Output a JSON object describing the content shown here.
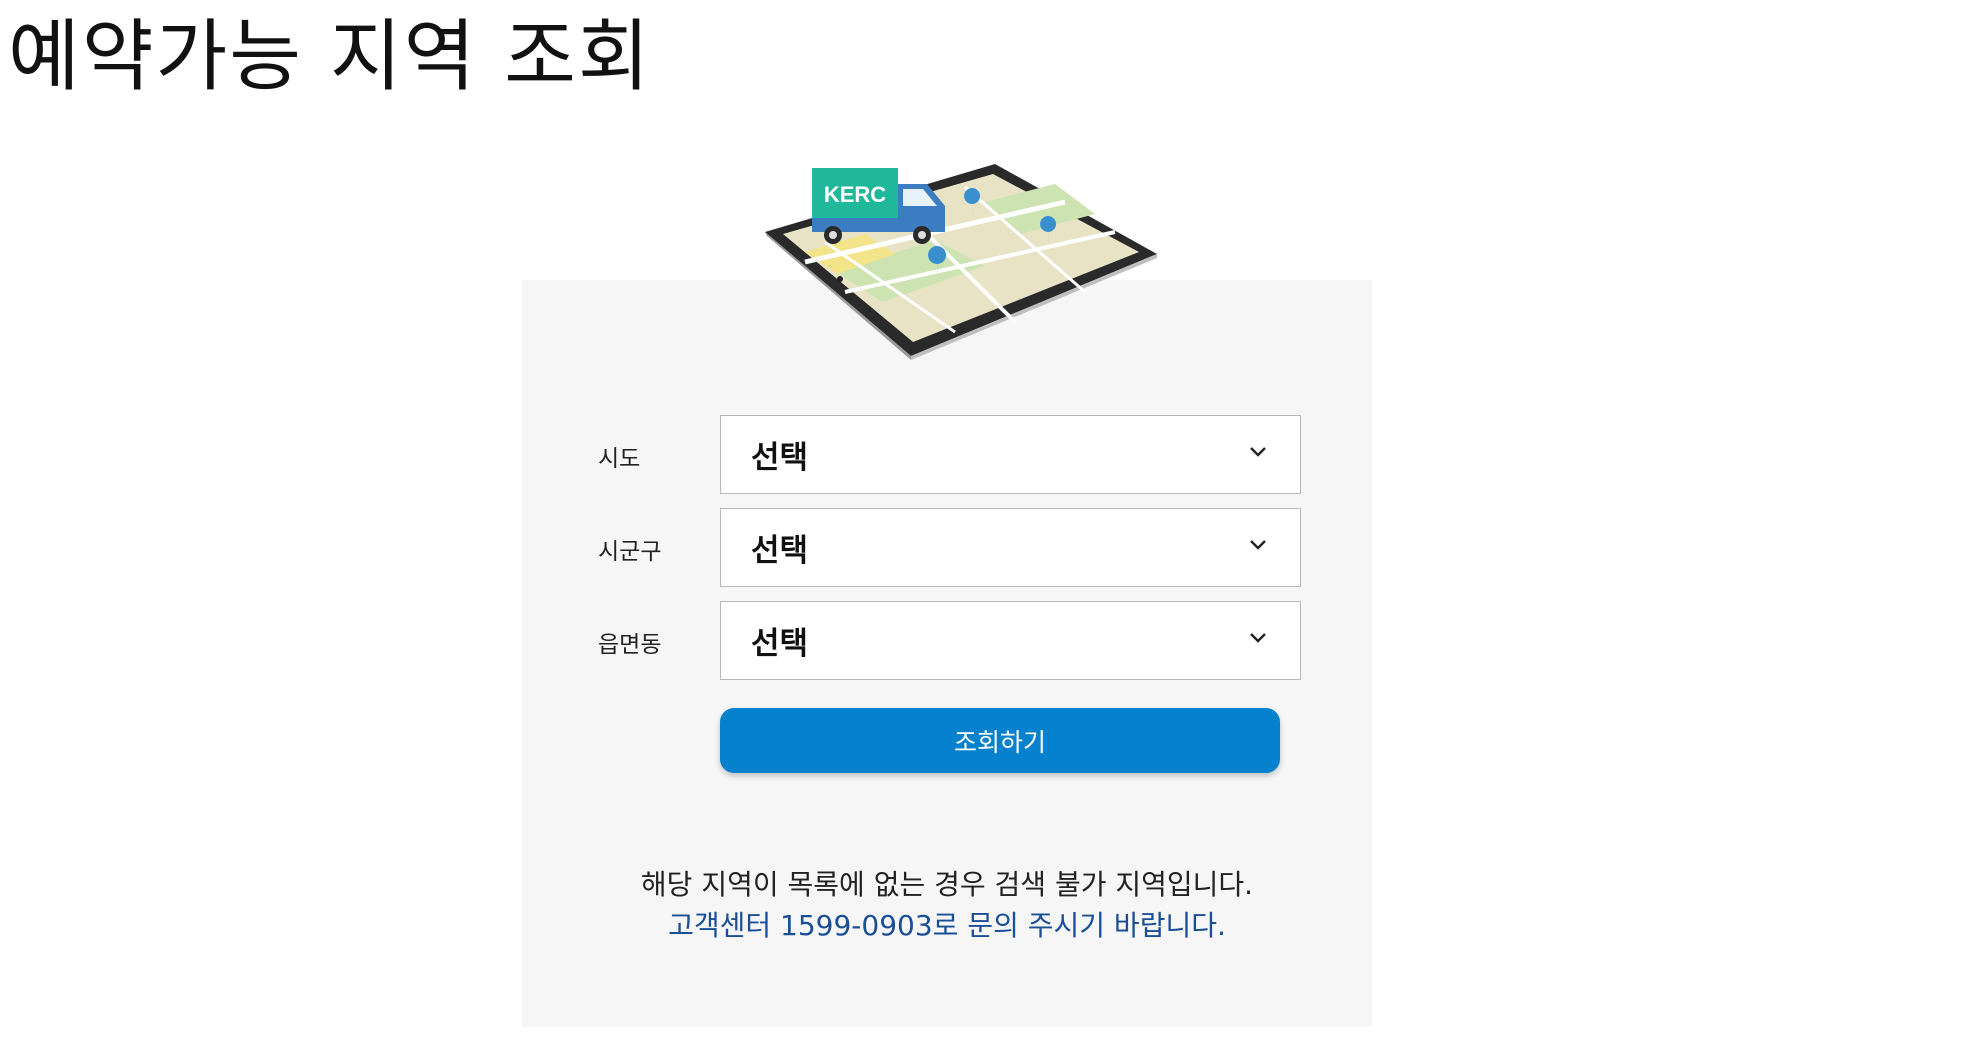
{
  "page": {
    "title": "예약가능 지역 조회"
  },
  "hero": {
    "truck_label": "KERC"
  },
  "form": {
    "fields": [
      {
        "label": "시도",
        "value": "선택"
      },
      {
        "label": "시군구",
        "value": "선택"
      },
      {
        "label": "읍면동",
        "value": "선택"
      }
    ],
    "submit_label": "조회하기"
  },
  "notice": {
    "line1": "해당 지역이 목록에 없는 경우 검색 불가 지역입니다.",
    "line2": "고객센터 1599-0903로 문의 주시기 바랍니다."
  },
  "colors": {
    "button": "#0581ce",
    "panel_bg": "#f6f6f6",
    "notice_link": "#1a4e96",
    "truck_box": "#1fb89a",
    "truck_cab": "#3c7cc0"
  },
  "icons": {
    "dropdown": "chevron-down-icon",
    "hero": "tablet-map-truck-illustration"
  }
}
